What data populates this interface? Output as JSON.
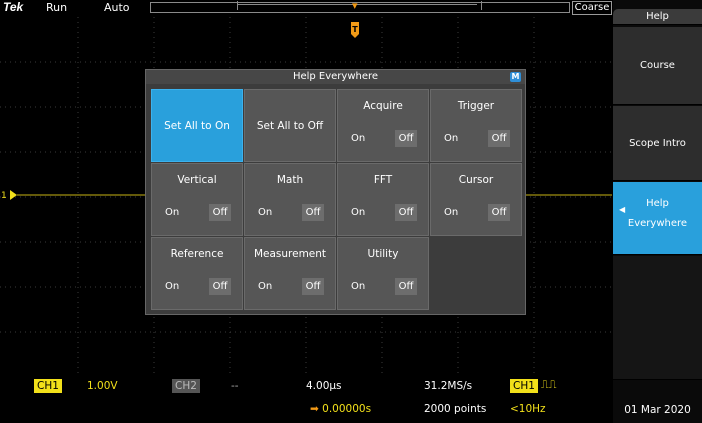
{
  "top": {
    "brand": "Tek",
    "state": "Run",
    "mode": "Auto",
    "coarse": "Coarse"
  },
  "side_menu": {
    "title": "Help",
    "items": [
      {
        "label": "Course"
      },
      {
        "label": "Scope Intro"
      },
      {
        "label_line1": "Help",
        "label_line2": "Everywhere",
        "selected": true
      }
    ],
    "date": "01 Mar 2020"
  },
  "dialog": {
    "title": "Help Everywhere",
    "badge": "M",
    "set_all_on": "Set All to On",
    "set_all_off": "Set All to Off",
    "tiles": [
      {
        "title": "Acquire",
        "on": "On",
        "off": "Off"
      },
      {
        "title": "Trigger",
        "on": "On",
        "off": "Off"
      },
      {
        "title": "Vertical",
        "on": "On",
        "off": "Off"
      },
      {
        "title": "Math",
        "on": "On",
        "off": "Off"
      },
      {
        "title": "FFT",
        "on": "On",
        "off": "Off"
      },
      {
        "title": "Cursor",
        "on": "On",
        "off": "Off"
      },
      {
        "title": "Reference",
        "on": "On",
        "off": "Off"
      },
      {
        "title": "Measurement",
        "on": "On",
        "off": "Off"
      },
      {
        "title": "Utility",
        "on": "On",
        "off": "Off"
      }
    ]
  },
  "status": {
    "ch1_label": "CH1",
    "ch1_scale": "1.00V",
    "ch2_label": "CH2",
    "ch2_scale": "--",
    "timebase": "4.00µs",
    "sample_rate": "31.2MS/s",
    "trigger_source": "CH1",
    "delay": "0.00000s",
    "record_length": "2000 points",
    "trigger_freq": "<10Hz",
    "ch1_marker": "1"
  },
  "colors": {
    "ch1": "#f2e01a",
    "accent": "#29a0dc",
    "trigger": "#f29a16"
  }
}
